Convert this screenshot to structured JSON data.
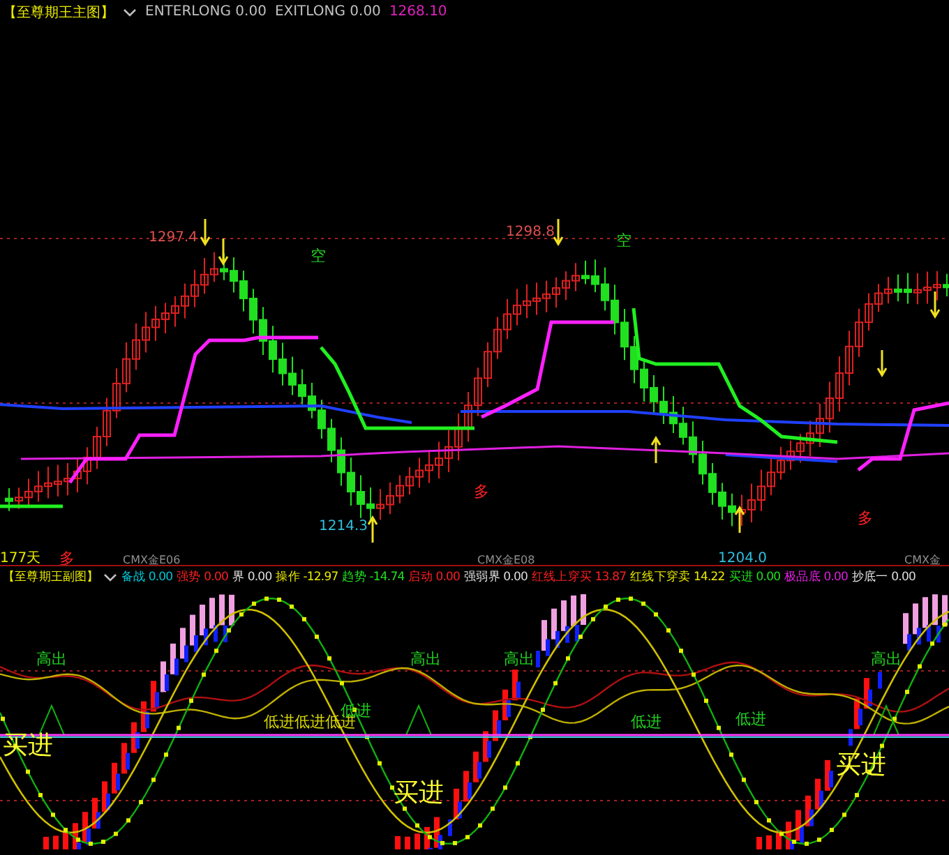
{
  "main_panel": {
    "title": "【至尊期王主图】",
    "legend": [
      {
        "label": "ENTERLONG",
        "value": "0.00",
        "kind": "plain"
      },
      {
        "label": "EXITLONG",
        "value": "0.00",
        "kind": "plain"
      }
    ],
    "price": "1268.10",
    "price_labels": [
      {
        "text": "1297.4",
        "kind": "high"
      },
      {
        "text": "1298.8",
        "kind": "high"
      },
      {
        "text": "1214.3",
        "kind": "low"
      },
      {
        "text": "1204.0",
        "kind": "low"
      }
    ],
    "signals": [
      {
        "text": "空",
        "kind": "short"
      },
      {
        "text": "空",
        "kind": "short"
      },
      {
        "text": "多",
        "kind": "long"
      },
      {
        "text": "多",
        "kind": "long"
      },
      {
        "text": "多",
        "kind": "long"
      }
    ],
    "period_label": "177天",
    "contract_labels": [
      "CMX金E06",
      "CMX金E08",
      "CMX金"
    ]
  },
  "sub_panel": {
    "title": "【至尊期王副图】",
    "legend": [
      {
        "label": "备战",
        "value": "0.00",
        "color": "#00c8d8"
      },
      {
        "label": "强势",
        "value": "0.00",
        "color": "#ff2020"
      },
      {
        "label": "界",
        "value": "0.00",
        "color": "#e0e0e0"
      },
      {
        "label": "操作",
        "value": "-12.97",
        "color": "#e8e800"
      },
      {
        "label": "趋势",
        "value": "-14.74",
        "color": "#20e020"
      },
      {
        "label": "启动",
        "value": "0.00",
        "color": "#ff2020"
      },
      {
        "label": "强弱界",
        "value": "0.00",
        "color": "#e0e0e0"
      },
      {
        "label": "红线上穿买",
        "value": "13.87",
        "color": "#ff2020"
      },
      {
        "label": "红线下穿卖",
        "value": "14.22",
        "color": "#e8e800"
      },
      {
        "label": "买进",
        "value": "0.00",
        "color": "#20e020"
      },
      {
        "label": "极品底",
        "value": "0.00",
        "color": "#e020e0"
      },
      {
        "label": "抄底一",
        "value": "0.00",
        "color": "#e0e0e0"
      }
    ],
    "signals": [
      {
        "text": "高出",
        "kind": "high"
      },
      {
        "text": "高出",
        "kind": "high"
      },
      {
        "text": "高出",
        "kind": "high"
      },
      {
        "text": "高出",
        "kind": "high"
      },
      {
        "text": "低进低进低进",
        "kind": "low_repeat"
      },
      {
        "text": "低进",
        "kind": "low"
      },
      {
        "text": "低进",
        "kind": "low"
      },
      {
        "text": "低进",
        "kind": "low"
      },
      {
        "text": "买进",
        "kind": "buy"
      },
      {
        "text": "买进",
        "kind": "buy"
      },
      {
        "text": "买进",
        "kind": "buy"
      }
    ]
  }
}
